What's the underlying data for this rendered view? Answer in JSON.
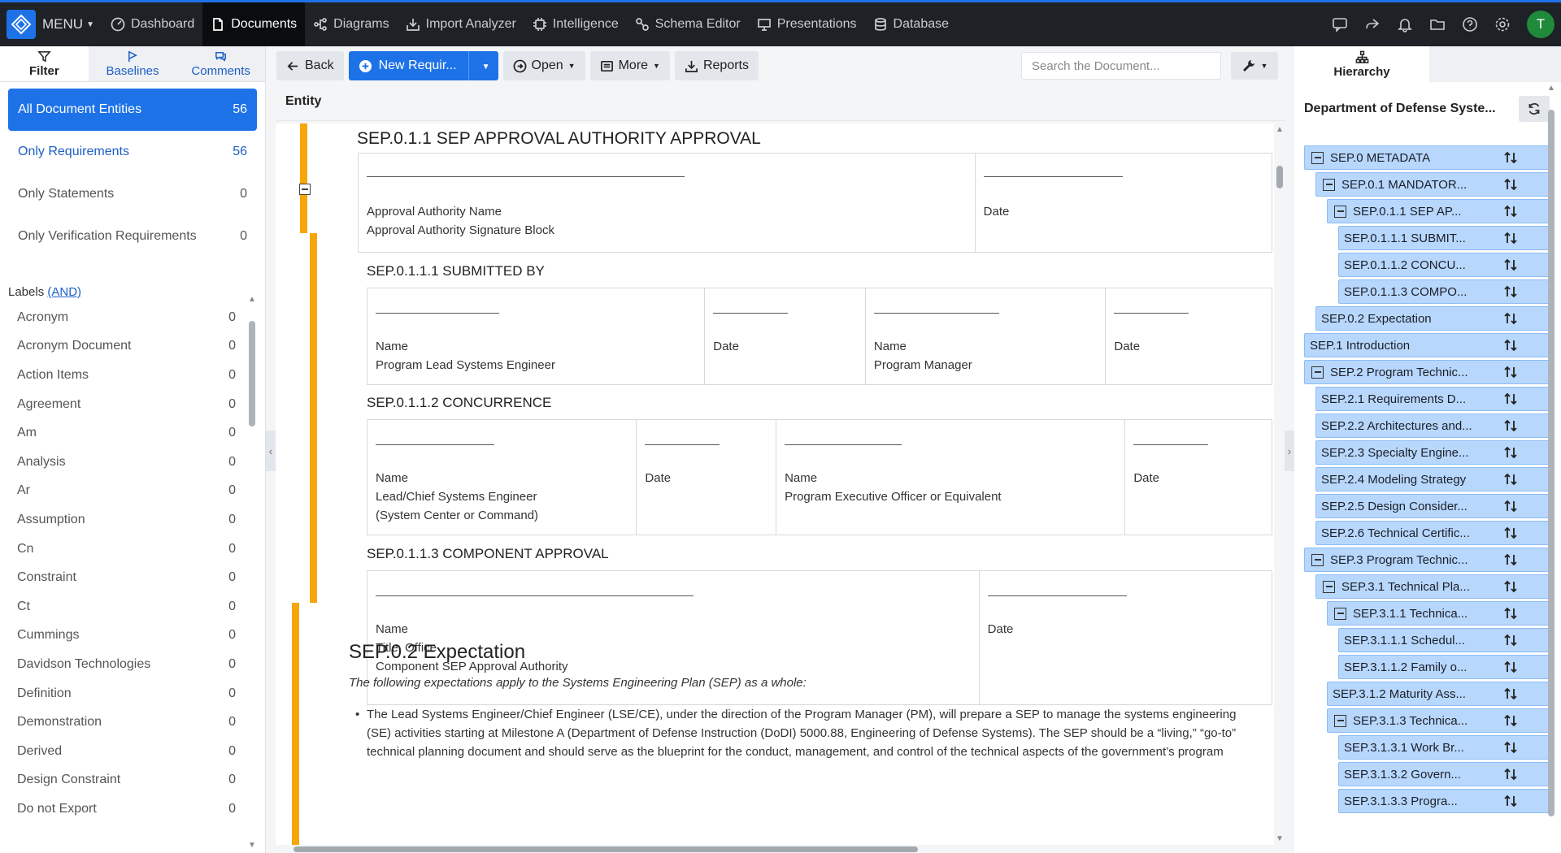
{
  "menu": {
    "label": "MENU"
  },
  "nav": [
    {
      "label": "Dashboard",
      "icon": "dashboard-icon"
    },
    {
      "label": "Documents",
      "icon": "document-icon",
      "active": true
    },
    {
      "label": "Diagrams",
      "icon": "diagram-icon"
    },
    {
      "label": "Import Analyzer",
      "icon": "import-icon"
    },
    {
      "label": "Intelligence",
      "icon": "intelligence-icon"
    },
    {
      "label": "Schema Editor",
      "icon": "schema-icon"
    },
    {
      "label": "Presentations",
      "icon": "presentation-icon"
    },
    {
      "label": "Database",
      "icon": "database-icon"
    }
  ],
  "user": {
    "initial": "T"
  },
  "left_tabs": [
    {
      "label": "Filter",
      "icon": "filter-icon"
    },
    {
      "label": "Baselines",
      "icon": "flag-icon"
    },
    {
      "label": "Comments",
      "icon": "comments-icon"
    }
  ],
  "entity_filters": [
    {
      "label": "All Document Entities",
      "count": "56"
    },
    {
      "label": "Only Requirements",
      "count": "56"
    },
    {
      "label": "Only Statements",
      "count": "0"
    },
    {
      "label": "Only Verification Requirements",
      "count": "0"
    }
  ],
  "labels": {
    "heading": "Labels",
    "mode": "(AND)",
    "items": [
      {
        "label": "Acronym",
        "count": "0"
      },
      {
        "label": "Acronym Document",
        "count": "0"
      },
      {
        "label": "Action Items",
        "count": "0"
      },
      {
        "label": "Agreement",
        "count": "0"
      },
      {
        "label": "Am",
        "count": "0"
      },
      {
        "label": "Analysis",
        "count": "0"
      },
      {
        "label": "Ar",
        "count": "0"
      },
      {
        "label": "Assumption",
        "count": "0"
      },
      {
        "label": "Cn",
        "count": "0"
      },
      {
        "label": "Constraint",
        "count": "0"
      },
      {
        "label": "Ct",
        "count": "0"
      },
      {
        "label": "Cummings",
        "count": "0"
      },
      {
        "label": "Davidson Technologies",
        "count": "0"
      },
      {
        "label": "Definition",
        "count": "0"
      },
      {
        "label": "Demonstration",
        "count": "0"
      },
      {
        "label": "Derived",
        "count": "0"
      },
      {
        "label": "Design Constraint",
        "count": "0"
      },
      {
        "label": "Do not Export",
        "count": "0"
      }
    ]
  },
  "toolbar": {
    "back": "Back",
    "new_req": "New Requir...",
    "open": "Open",
    "more": "More",
    "reports": "Reports",
    "search_placeholder": "Search the Document..."
  },
  "entity_header": "Entity",
  "doc": {
    "sec1_title": "SEP.0.1.1 SEP APPROVAL AUTHORITY APPROVAL",
    "sec1_cells": [
      {
        "lines": [
          "Approval Authority Name",
          "Approval Authority Signature Block"
        ]
      },
      {
        "lines": [
          "Date"
        ]
      }
    ],
    "sub1_title": "SEP.0.1.1.1 SUBMITTED BY",
    "sub1_cells": [
      {
        "lines": [
          "Name",
          "Program Lead Systems Engineer"
        ]
      },
      {
        "lines": [
          "Date"
        ]
      },
      {
        "lines": [
          "Name",
          "Program Manager"
        ]
      },
      {
        "lines": [
          "Date"
        ]
      }
    ],
    "sub2_title": "SEP.0.1.1.2 CONCURRENCE",
    "sub2_cells": [
      {
        "lines": [
          "Name",
          "Lead/Chief Systems Engineer",
          "(System Center or Command)"
        ]
      },
      {
        "lines": [
          "Date"
        ]
      },
      {
        "lines": [
          "Name",
          "Program Executive Officer or Equivalent"
        ]
      },
      {
        "lines": [
          "Date"
        ]
      }
    ],
    "sub3_title": "SEP.0.1.1.3 COMPONENT APPROVAL",
    "sub3_cells": [
      {
        "lines": [
          "Name",
          "Title, Office",
          "Component SEP Approval Authority"
        ]
      },
      {
        "lines": [
          "Date"
        ]
      }
    ],
    "exp_title": "SEP.0.2 Expectation",
    "exp_intro": "The following expectations apply to the Systems Engineering Plan (SEP) as a whole:",
    "exp_bullet": "The Lead Systems Engineer/Chief Engineer (LSE/CE), under the direction of the Program Manager (PM), will prepare a SEP to manage the systems engineering (SE) activities starting at Milestone A (Department of Defense Instruction (DoDI) 5000.88, Engineering of Defense Systems). The SEP should be a “living,” “go-to” technical planning document and should serve as the blueprint for the conduct, management, and control of the technical aspects of the government’s program"
  },
  "right": {
    "tab": "Hierarchy",
    "department": "Department of Defense Syste...",
    "tree": [
      {
        "label": "SEP.0 METADATA",
        "level": 0,
        "box": true
      },
      {
        "label": "SEP.0.1 MANDATOR...",
        "level": 1,
        "box": true
      },
      {
        "label": "SEP.0.1.1 SEP AP...",
        "level": 2,
        "box": true
      },
      {
        "label": "SEP.0.1.1.1 SUBMIT...",
        "level": 3,
        "box": false
      },
      {
        "label": "SEP.0.1.1.2 CONCU...",
        "level": 3,
        "box": false
      },
      {
        "label": "SEP.0.1.1.3 COMPO...",
        "level": 3,
        "box": false
      },
      {
        "label": "SEP.0.2 Expectation",
        "level": 1,
        "box": false
      },
      {
        "label": "SEP.1 Introduction",
        "level": 0,
        "box": false
      },
      {
        "label": "SEP.2 Program Technic...",
        "level": 0,
        "box": true
      },
      {
        "label": "SEP.2.1 Requirements D...",
        "level": 1,
        "box": false
      },
      {
        "label": "SEP.2.2 Architectures and...",
        "level": 1,
        "box": false
      },
      {
        "label": "SEP.2.3 Specialty Engine...",
        "level": 1,
        "box": false
      },
      {
        "label": "SEP.2.4 Modeling Strategy",
        "level": 1,
        "box": false
      },
      {
        "label": "SEP.2.5 Design Consider...",
        "level": 1,
        "box": false
      },
      {
        "label": "SEP.2.6 Technical Certific...",
        "level": 1,
        "box": false
      },
      {
        "label": "SEP.3 Program Technic...",
        "level": 0,
        "box": true
      },
      {
        "label": "SEP.3.1 Technical Pla...",
        "level": 1,
        "box": true
      },
      {
        "label": "SEP.3.1.1 Technica...",
        "level": 2,
        "box": true
      },
      {
        "label": "SEP.3.1.1.1 Schedul...",
        "level": 3,
        "box": false
      },
      {
        "label": "SEP.3.1.1.2 Family o...",
        "level": 3,
        "box": false
      },
      {
        "label": "SEP.3.1.2 Maturity Ass...",
        "level": 2,
        "box": false
      },
      {
        "label": "SEP.3.1.3 Technica...",
        "level": 2,
        "box": true
      },
      {
        "label": "SEP.3.1.3.1 Work Br...",
        "level": 3,
        "box": false
      },
      {
        "label": "SEP.3.1.3.2 Govern...",
        "level": 3,
        "box": false
      },
      {
        "label": "SEP.3.1.3.3 Progra...",
        "level": 3,
        "box": false
      }
    ]
  },
  "colors": {
    "accent": "#1d72e8",
    "section_bar": "#f6a609",
    "tree_node": "#b8d7fc",
    "topbar": "#1e2126"
  }
}
